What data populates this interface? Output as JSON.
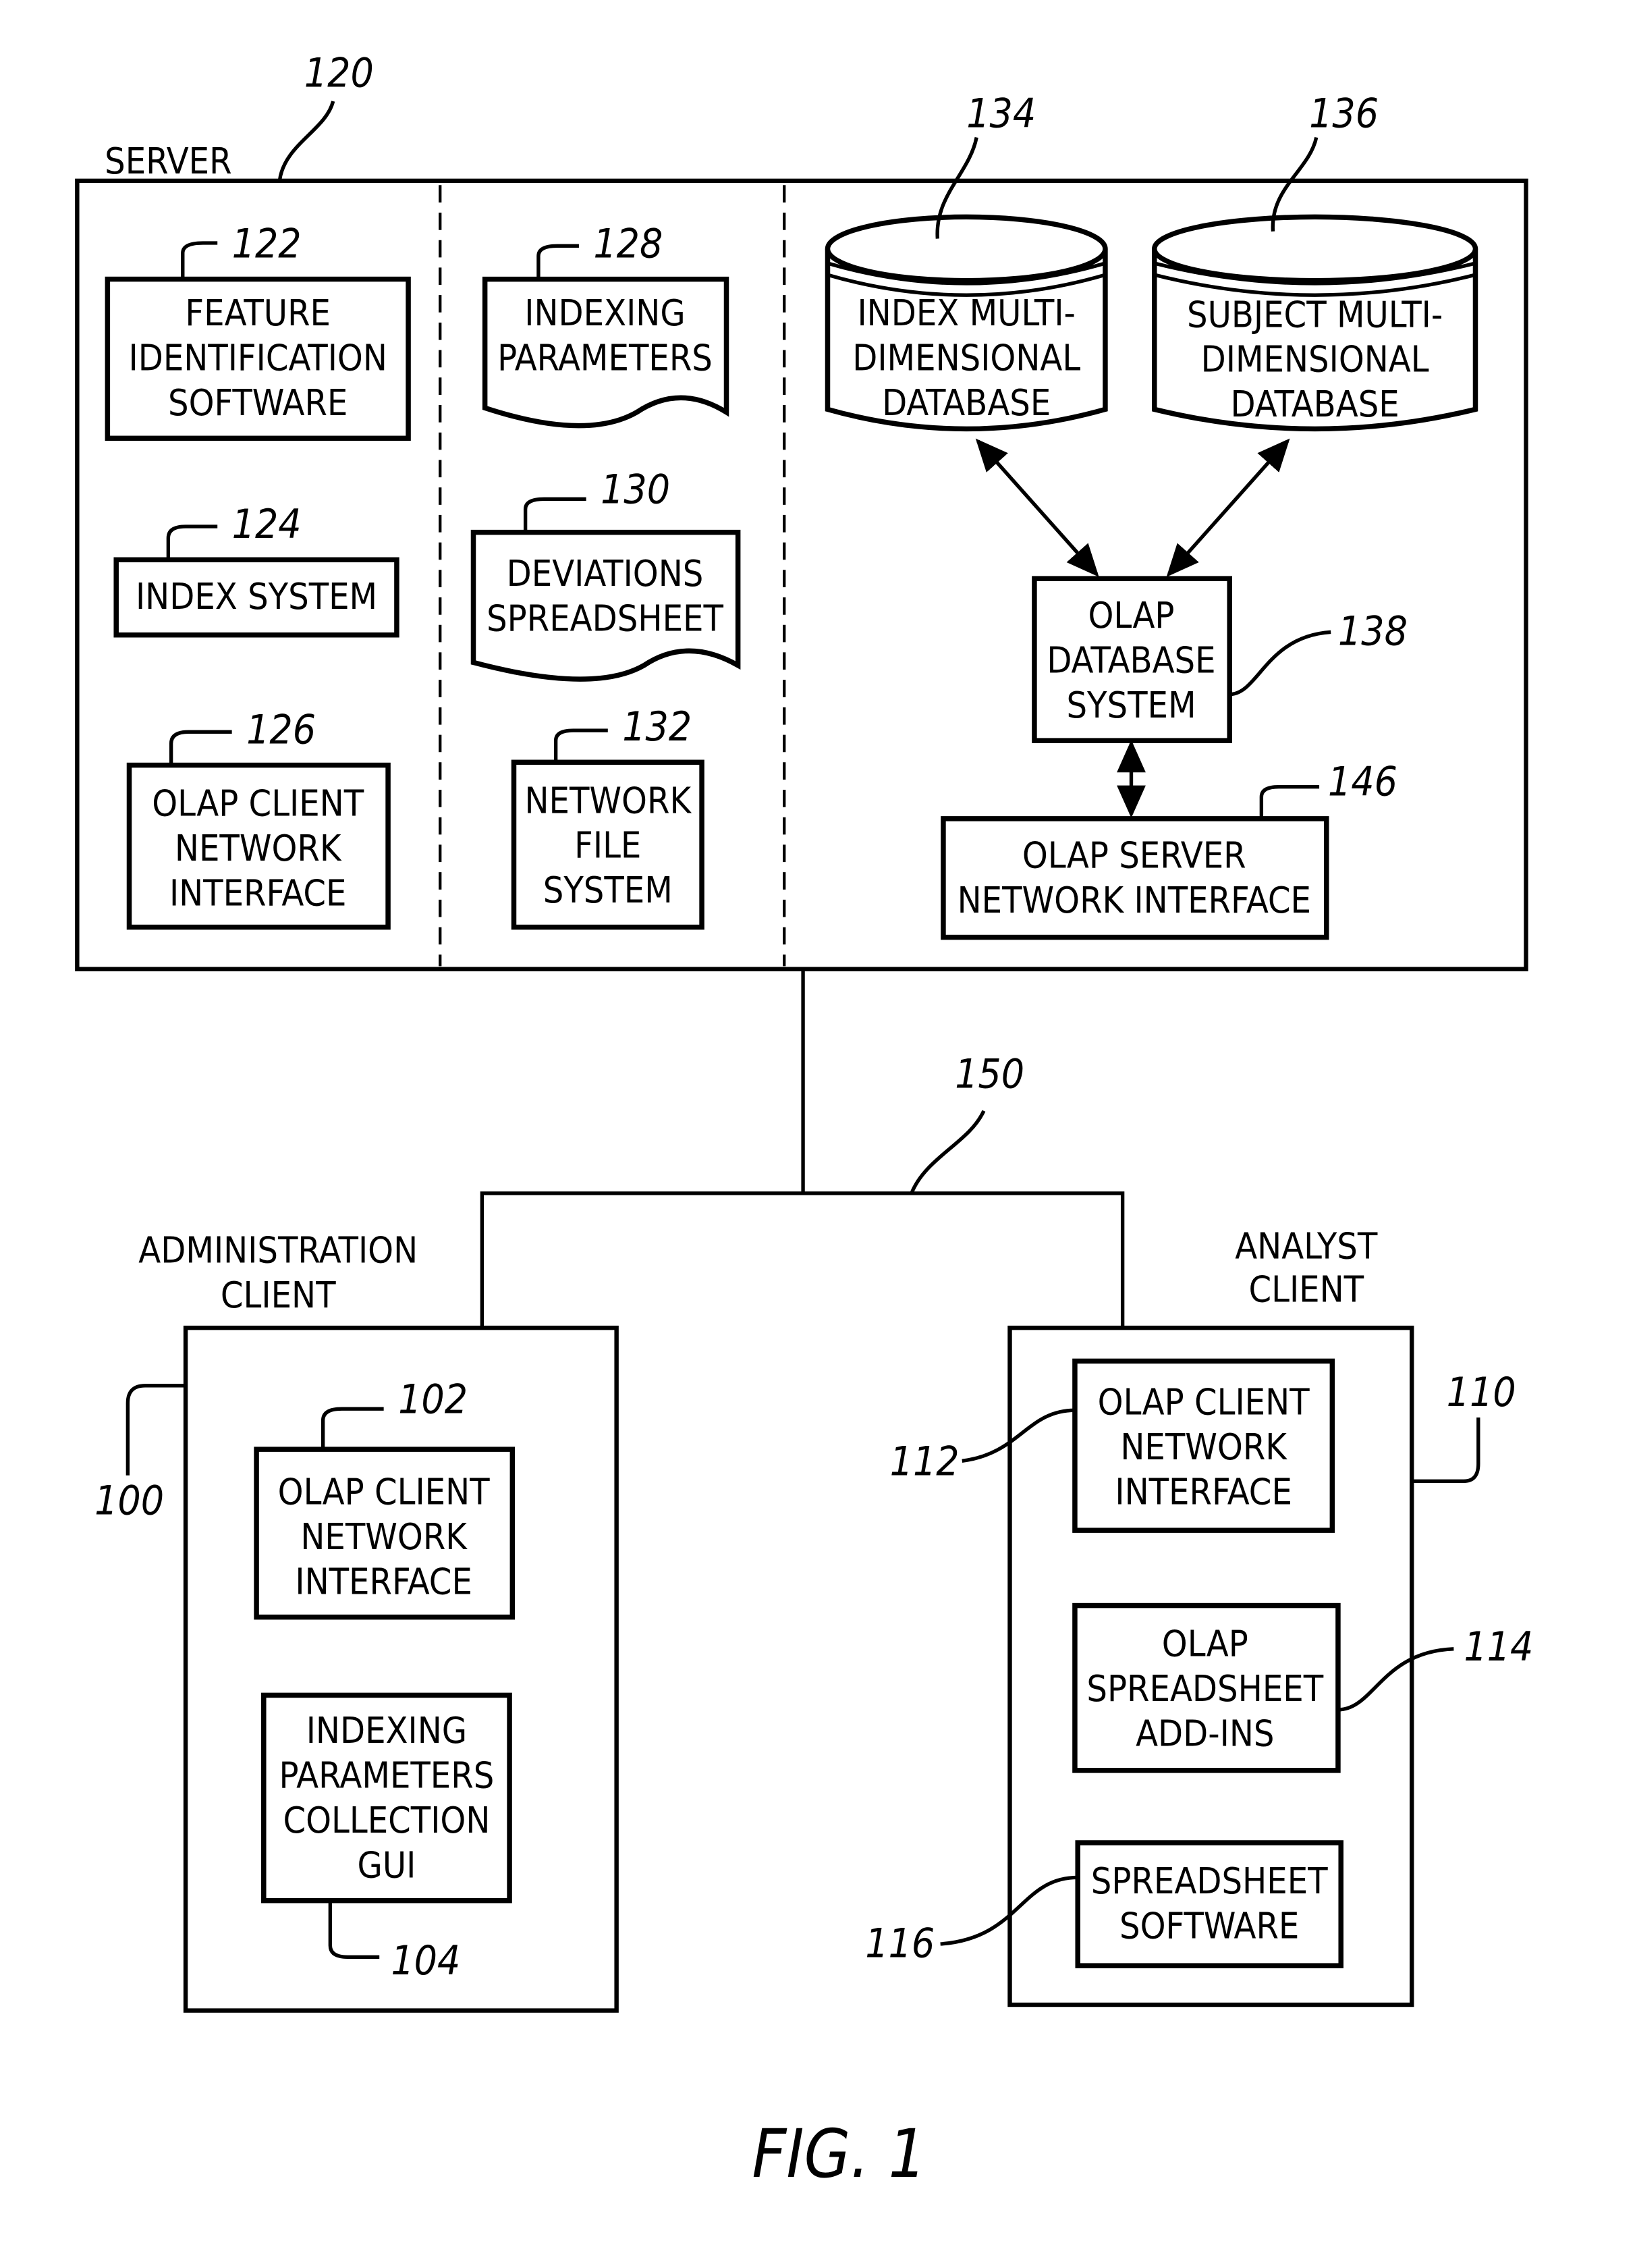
{
  "figure_label": "FIG. 1",
  "server": {
    "title": "SERVER",
    "ref": "120"
  },
  "network": {
    "ref": "150"
  },
  "admin": {
    "title": [
      "ADMINISTRATION",
      "CLIENT"
    ],
    "ref": "100"
  },
  "analyst": {
    "title": [
      "ANALYST",
      "CLIENT"
    ],
    "ref": "110"
  },
  "blocks": {
    "b122": {
      "ref": "122",
      "lines": [
        "FEATURE",
        "IDENTIFICATION",
        "SOFTWARE"
      ]
    },
    "b124": {
      "ref": "124",
      "lines": [
        "INDEX SYSTEM"
      ]
    },
    "b126": {
      "ref": "126",
      "lines": [
        "OLAP CLIENT",
        "NETWORK",
        "INTERFACE"
      ]
    },
    "b128": {
      "ref": "128",
      "lines": [
        "INDEXING",
        "PARAMETERS"
      ]
    },
    "b130": {
      "ref": "130",
      "lines": [
        "DEVIATIONS",
        "SPREADSHEET"
      ]
    },
    "b132": {
      "ref": "132",
      "lines": [
        "NETWORK",
        "FILE",
        "SYSTEM"
      ]
    },
    "b134": {
      "ref": "134",
      "lines": [
        "INDEX MULTI-",
        "DIMENSIONAL",
        "DATABASE"
      ]
    },
    "b136": {
      "ref": "136",
      "lines": [
        "SUBJECT MULTI-",
        "DIMENSIONAL",
        "DATABASE"
      ]
    },
    "b138": {
      "ref": "138",
      "lines": [
        "OLAP",
        "DATABASE",
        "SYSTEM"
      ]
    },
    "b146": {
      "ref": "146",
      "lines": [
        "OLAP SERVER",
        "NETWORK INTERFACE"
      ]
    },
    "b102": {
      "ref": "102",
      "lines": [
        "OLAP CLIENT",
        "NETWORK",
        "INTERFACE"
      ]
    },
    "b104": {
      "ref": "104",
      "lines": [
        "INDEXING",
        "PARAMETERS",
        "COLLECTION",
        "GUI"
      ]
    },
    "b112": {
      "ref": "112",
      "lines": [
        "OLAP CLIENT",
        "NETWORK",
        "INTERFACE"
      ]
    },
    "b114": {
      "ref": "114",
      "lines": [
        "OLAP",
        "SPREADSHEET",
        "ADD-INS"
      ]
    },
    "b116": {
      "ref": "116",
      "lines": [
        "SPREADSHEET",
        "SOFTWARE"
      ]
    }
  }
}
